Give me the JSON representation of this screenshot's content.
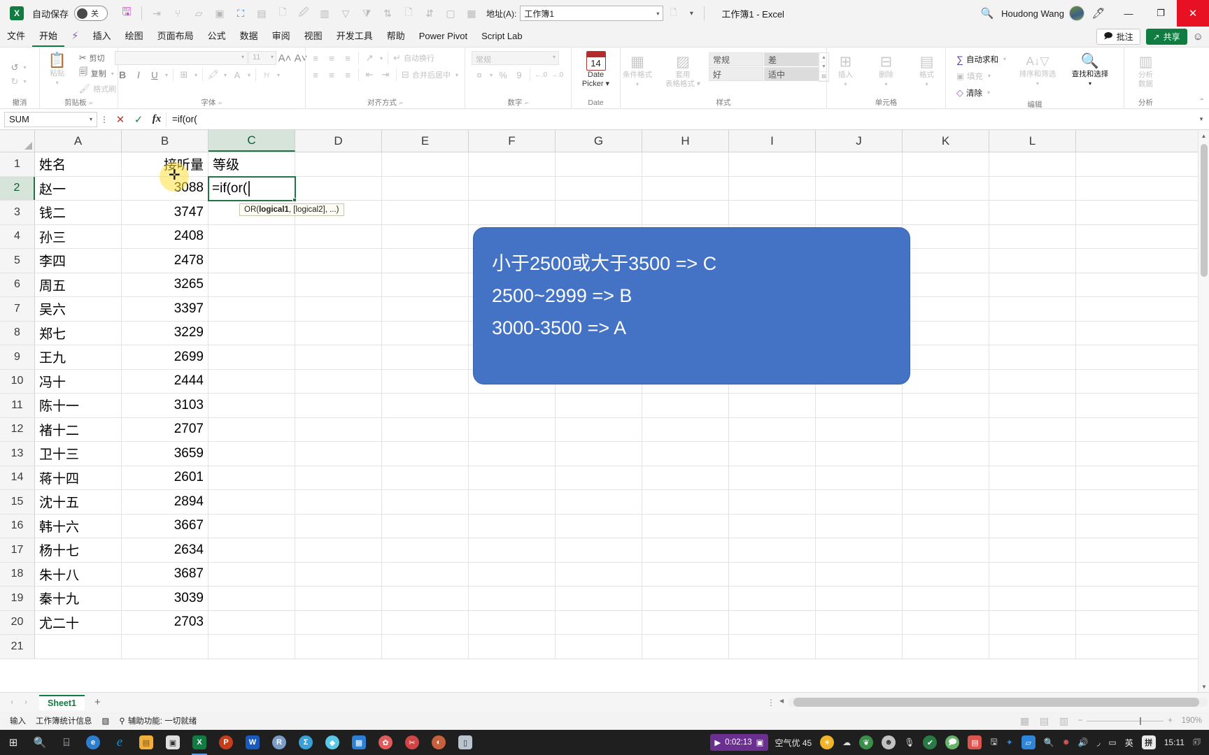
{
  "titlebar": {
    "autosave_label": "自动保存",
    "toggle_state": "关",
    "address_label": "地址(A):",
    "address_value": "工作簿1",
    "window_title": "工作簿1  -  Excel",
    "user_name": "Houdong Wang",
    "search_icon": "search-icon",
    "qat_icons": [
      "save-icon",
      "insert-row-icon",
      "merge-icon",
      "open-folder-icon",
      "freeze-panes-icon",
      "select-all-icon",
      "table-icon",
      "new-sheet-icon",
      "clip-icon",
      "border-icon",
      "filter-icon",
      "clear-filter-icon",
      "sort-az-icon",
      "page-icon",
      "sort-za-icon",
      "camera-icon",
      "calculator-icon"
    ],
    "minimize": "—",
    "restore": "❐",
    "close": "✕"
  },
  "tabs": {
    "items": [
      {
        "label": "文件",
        "active": false
      },
      {
        "label": "开始",
        "active": true
      },
      {
        "label": "",
        "active": false,
        "icon": "lightning-icon"
      },
      {
        "label": "插入",
        "active": false
      },
      {
        "label": "绘图",
        "active": false
      },
      {
        "label": "页面布局",
        "active": false
      },
      {
        "label": "公式",
        "active": false
      },
      {
        "label": "数据",
        "active": false
      },
      {
        "label": "审阅",
        "active": false
      },
      {
        "label": "视图",
        "active": false
      },
      {
        "label": "开发工具",
        "active": false
      },
      {
        "label": "帮助",
        "active": false
      },
      {
        "label": "Power Pivot",
        "active": false
      },
      {
        "label": "Script Lab",
        "active": false
      }
    ],
    "comment_button": "批注",
    "share_button": "共享",
    "smiley_icon": "smiley-icon"
  },
  "ribbon": {
    "groups": [
      {
        "name": "撤消",
        "label": "撤消",
        "buttons": [
          {
            "label": "",
            "icon": "undo-icon"
          },
          {
            "label": "",
            "icon": "redo-icon"
          }
        ]
      },
      {
        "name": "剪贴板",
        "label": "剪贴板",
        "paste_label": "粘贴",
        "cut_label": "剪切",
        "copy_label": "复制",
        "format_painter_label": "格式刷"
      },
      {
        "name": "字体",
        "label": "字体",
        "font_name": "",
        "font_size": "11",
        "grow_font": "A",
        "shrink_font": "A",
        "bold": "B",
        "italic": "I",
        "underline": "U",
        "borders_icon": "borders-icon",
        "fill_color_icon": "fill-color-icon",
        "font_color_icon": "font-color-icon",
        "phonetic_icon": "phonetic-icon"
      },
      {
        "name": "对齐方式",
        "label": "对齐方式",
        "wrap_text_label": "自动换行",
        "merge_center_label": "合并后居中",
        "orientation_icon": "orientation-icon"
      },
      {
        "name": "数字",
        "label": "数字",
        "format_value": "常规",
        "accounting_icon": "accounting-icon",
        "percent": "%",
        "comma": "9",
        "inc_decimal_icon": "increase-decimal-icon",
        "dec_decimal_icon": "decrease-decimal-icon"
      },
      {
        "name": "Date",
        "label": "Date",
        "date_picker_line1": "Date",
        "date_picker_line2": "Picker",
        "calendar_day": "14"
      },
      {
        "name": "样式",
        "label": "样式",
        "conditional_format_label": "条件格式",
        "table_format_line1": "套用",
        "table_format_line2": "表格格式",
        "cell_styles": [
          "常规",
          "差",
          "好",
          "适中"
        ]
      },
      {
        "name": "单元格",
        "label": "单元格",
        "insert_label": "插入",
        "delete_label": "删除",
        "format_label": "格式"
      },
      {
        "name": "编辑",
        "label": "编辑",
        "autosum_label": "自动求和",
        "fill_label": "填充",
        "clear_label": "清除",
        "sort_filter_label": "排序和筛选",
        "find_select_label": "查找和选择"
      },
      {
        "name": "分析",
        "label": "分析",
        "analyze_line1": "分析",
        "analyze_line2": "数据"
      }
    ]
  },
  "formula_bar": {
    "name_box": "SUM",
    "cancel_icon": "cancel-icon",
    "enter_icon": "enter-icon",
    "fx_icon": "fx-icon",
    "formula": "=if(or("
  },
  "grid": {
    "columns": [
      "A",
      "B",
      "C",
      "D",
      "E",
      "F",
      "G",
      "H",
      "I",
      "J",
      "K",
      "L"
    ],
    "selected_column": "C",
    "selected_row": "2",
    "active_cell_text": "=if(or(",
    "tooltip": "OR(logical1, [logical2], ...)",
    "tooltip_bold": "logical1",
    "rows": [
      {
        "n": "1",
        "a": "姓名",
        "b": "接听量",
        "c": "等级"
      },
      {
        "n": "2",
        "a": "赵一",
        "b": "3088",
        "c": ""
      },
      {
        "n": "3",
        "a": "钱二",
        "b": "3747",
        "c": ""
      },
      {
        "n": "4",
        "a": "孙三",
        "b": "2408",
        "c": ""
      },
      {
        "n": "5",
        "a": "李四",
        "b": "2478",
        "c": ""
      },
      {
        "n": "6",
        "a": "周五",
        "b": "3265",
        "c": ""
      },
      {
        "n": "7",
        "a": "吴六",
        "b": "3397",
        "c": ""
      },
      {
        "n": "8",
        "a": "郑七",
        "b": "3229",
        "c": ""
      },
      {
        "n": "9",
        "a": "王九",
        "b": "2699",
        "c": ""
      },
      {
        "n": "10",
        "a": "冯十",
        "b": "2444",
        "c": ""
      },
      {
        "n": "11",
        "a": "陈十一",
        "b": "3103",
        "c": ""
      },
      {
        "n": "12",
        "a": "褚十二",
        "b": "2707",
        "c": ""
      },
      {
        "n": "13",
        "a": "卫十三",
        "b": "3659",
        "c": ""
      },
      {
        "n": "14",
        "a": "蒋十四",
        "b": "2601",
        "c": ""
      },
      {
        "n": "15",
        "a": "沈十五",
        "b": "2894",
        "c": ""
      },
      {
        "n": "16",
        "a": "韩十六",
        "b": "3667",
        "c": ""
      },
      {
        "n": "17",
        "a": "杨十七",
        "b": "2634",
        "c": ""
      },
      {
        "n": "18",
        "a": "朱十八",
        "b": "3687",
        "c": ""
      },
      {
        "n": "19",
        "a": "秦十九",
        "b": "3039",
        "c": ""
      },
      {
        "n": "20",
        "a": "尤二十",
        "b": "2703",
        "c": ""
      },
      {
        "n": "21",
        "a": "",
        "b": "",
        "c": ""
      }
    ]
  },
  "callout": {
    "color": "#4472c4",
    "lines": [
      "小于2500或大于3500 => C",
      "2500~2999 => B",
      "3000-3500 => A"
    ]
  },
  "sheetbar": {
    "sheet_name": "Sheet1",
    "add_sheet": "+"
  },
  "statusbar": {
    "mode": "输入",
    "workbook_stats": "工作簿统计信息",
    "accessibility": "辅助功能: 一切就绪",
    "zoom": "190%",
    "view_normal_icon": "normal-view-icon",
    "view_layout_icon": "page-layout-icon",
    "view_pagebreak_icon": "page-break-icon",
    "zoom_out": "−",
    "zoom_in": "+"
  },
  "taskbar": {
    "start_icon": "windows-start-icon",
    "search_icon": "search-icon",
    "taskview_icon": "task-view-icon",
    "apps": [
      {
        "name": "edge-icon",
        "glyph": "e",
        "color": "#2c7fd0"
      },
      {
        "name": "ie-icon",
        "glyph": "e",
        "color": "#1a8fd0"
      },
      {
        "name": "file-explorer-icon",
        "glyph": "▤",
        "color": "#f0ae3c"
      },
      {
        "name": "store-icon",
        "glyph": "▣",
        "color": "#d9d9d9"
      },
      {
        "name": "excel-icon",
        "glyph": "X",
        "color": "#107c41"
      },
      {
        "name": "powerpoint-icon",
        "glyph": "P",
        "color": "#c43e1c"
      },
      {
        "name": "word-icon",
        "glyph": "W",
        "color": "#185abd"
      },
      {
        "name": "r-icon",
        "glyph": "R",
        "color": "#7a9cc6"
      },
      {
        "name": "sigma-icon",
        "glyph": "Σ",
        "color": "#3aa0d9"
      },
      {
        "name": "gem-icon",
        "glyph": "◆",
        "color": "#5ac8e8"
      },
      {
        "name": "calendar-icon",
        "glyph": "▦",
        "color": "#2d7fd3"
      },
      {
        "name": "paint-icon",
        "glyph": "✿",
        "color": "#e05c5c"
      },
      {
        "name": "scissors-icon",
        "glyph": "✂",
        "color": "#d04545"
      },
      {
        "name": "palette-icon",
        "glyph": "◐",
        "color": "#c7603c"
      },
      {
        "name": "notepad-icon",
        "glyph": "▯",
        "color": "#b9c4cf"
      }
    ],
    "media_time": "0:02:13",
    "weather": "空气优 45",
    "tray_icons": [
      "weather-icon",
      "cloud-icon",
      "leaf-icon",
      "face-icon",
      "mic-icon",
      "shield-icon",
      "chat-icon",
      "folder-icon",
      "usb-icon",
      "bluetooth-icon",
      "blue-app-icon",
      "search-orange-icon",
      "red-dot-icon",
      "volume-icon",
      "wifi-icon",
      "battery-icon"
    ],
    "ime": "英",
    "ime2": "拼",
    "clock": "15:11",
    "notification_icon": "notification-icon"
  }
}
